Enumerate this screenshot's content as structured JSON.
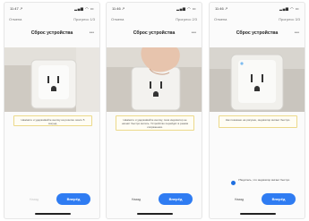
{
  "screens": [
    {
      "status": {
        "time": "11:47 ↗",
        "signal": "▂▄▆ ◠ ▭"
      },
      "nav": {
        "back": "Отмена",
        "count": "Прогресс 1/3"
      },
      "title": "Сброс устройства",
      "menu_icon": "more-icon",
      "page_indicator": {
        "total": 3,
        "current": 1
      },
      "tip": "Нажмите и удерживайте кнопку на розетке около 5 секунд.",
      "checkbox_label": "",
      "secondary_label": "Назад",
      "secondary_enabled": false,
      "primary_label": "Вперёд"
    },
    {
      "status": {
        "time": "11:46 ↗",
        "signal": "▂▄▆ ◠ ▭"
      },
      "nav": {
        "back": "Отмена",
        "count": "Прогресс 2/3"
      },
      "title": "Сброс устройства",
      "menu_icon": "more-icon",
      "page_indicator": {
        "total": 3,
        "current": 2
      },
      "tip": "Нажмите и удерживайте кнопку, пока индикатор не начнёт быстро мигать. Устройство перейдёт в режим сопряжения.",
      "checkbox_label": "",
      "secondary_label": "Назад",
      "secondary_enabled": true,
      "primary_label": "Вперёд"
    },
    {
      "status": {
        "time": "11:46 ↗",
        "signal": "▂▄▆ ◠ ▭"
      },
      "nav": {
        "back": "Отмена",
        "count": "Прогресс 3/3"
      },
      "title": "Сброс устройства",
      "menu_icon": "more-icon",
      "page_indicator": {
        "total": 3,
        "current": 3
      },
      "tip": "Как показано на рисунке, индикатор мигает быстро.",
      "checkbox_label": "Убедитесь, что индикатор мигает быстро",
      "secondary_label": "Назад",
      "secondary_enabled": true,
      "primary_label": "Вперёд"
    }
  ]
}
